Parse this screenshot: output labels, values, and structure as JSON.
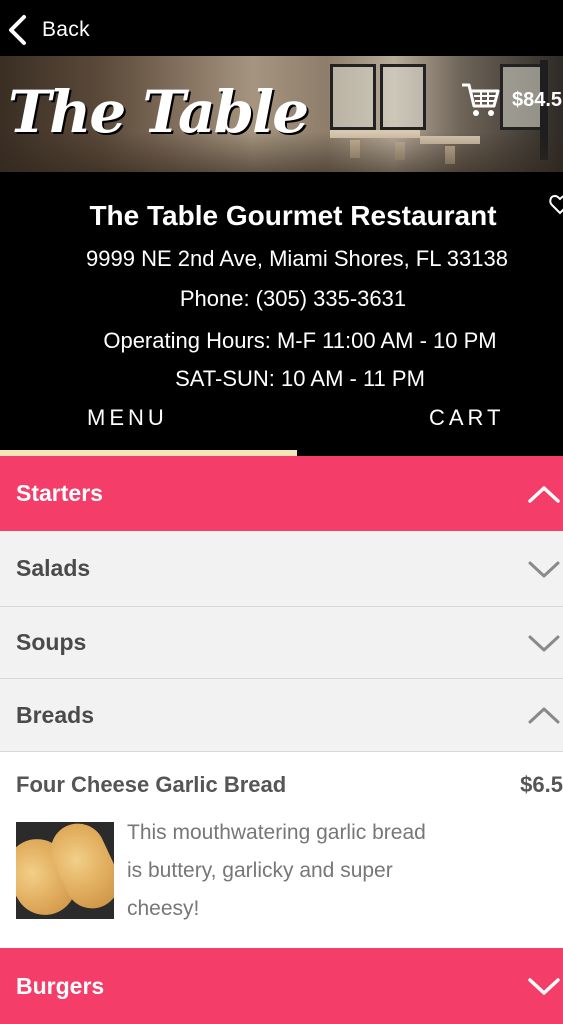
{
  "nav": {
    "back_label": "Back"
  },
  "banner": {
    "logo_text": "The Table",
    "cart_total": "$84.5"
  },
  "restaurant": {
    "name": "The Table Gourmet Restaurant",
    "address": "9999 NE 2nd Ave, Miami Shores, FL 33138",
    "phone": "Phone: (305) 335-3631",
    "hours_line1": "Operating Hours: M-F 11:00 AM - 10 PM",
    "hours_line2": "SAT-SUN: 10 AM - 11 PM"
  },
  "tabs": [
    {
      "label": "MENU",
      "active": true
    },
    {
      "label": "CART",
      "active": false
    }
  ],
  "categories": [
    {
      "label": "Starters",
      "expanded": true
    },
    {
      "label": "Salads",
      "expanded": false
    },
    {
      "label": "Soups",
      "expanded": false
    },
    {
      "label": "Breads",
      "expanded": true
    },
    {
      "label": "Burgers",
      "expanded": false
    }
  ],
  "menu_item": {
    "name": "Four Cheese Garlic Bread",
    "price": "$6.5",
    "description": "This mouthwatering garlic bread is buttery, garlicky and super cheesy!"
  },
  "colors": {
    "accent_pink": "#f43d68",
    "tab_indicator": "#f5e6b8",
    "header_bg": "#000000"
  },
  "icons": [
    "chevron-left-icon",
    "shopping-cart-icon",
    "heart-icon",
    "chevron-up-icon",
    "chevron-down-icon"
  ]
}
